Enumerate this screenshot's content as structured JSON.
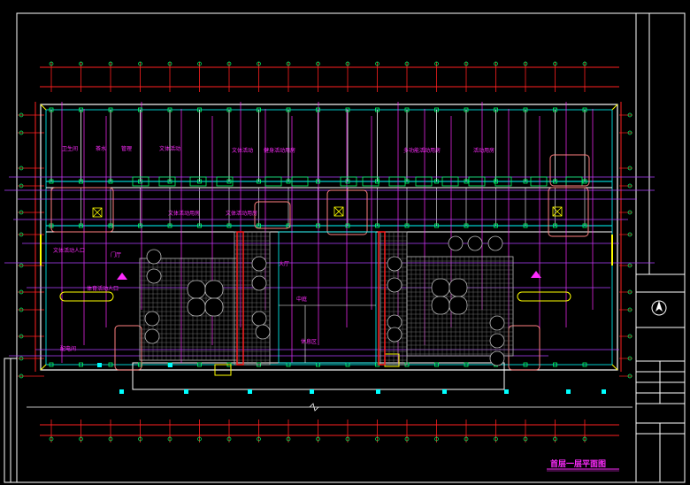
{
  "drawing": {
    "title": "首层一层平面图",
    "subtitle": "",
    "rooms": [
      {
        "id": "r1",
        "text": "卫生间"
      },
      {
        "id": "r2",
        "text": "茶水"
      },
      {
        "id": "r3",
        "text": "管理"
      },
      {
        "id": "r4",
        "text": "文体活动"
      },
      {
        "id": "r5",
        "text": "文体活动"
      },
      {
        "id": "r6",
        "text": "健身活动用房"
      },
      {
        "id": "r7",
        "text": "多功能活动用房"
      },
      {
        "id": "r8",
        "text": "活动用房"
      },
      {
        "id": "r9",
        "text": "文体活动用房"
      },
      {
        "id": "r10",
        "text": "文体活动用房"
      },
      {
        "id": "r11",
        "text": "文体活动人口"
      },
      {
        "id": "r12",
        "text": "体育活动人口"
      },
      {
        "id": "r13",
        "text": "门厅"
      },
      {
        "id": "r14",
        "text": "大厅"
      },
      {
        "id": "r15",
        "text": "中庭"
      },
      {
        "id": "r16",
        "text": "休息区"
      },
      {
        "id": "r17",
        "text": "配电间"
      }
    ]
  },
  "colors": {
    "background": "#000000",
    "frame": "#ffffff",
    "axis": "#ff2020",
    "grid": "#ffffff",
    "wall_cyan": "#00ffff",
    "wall_green": "#00ff66",
    "magenta": "#ff2bff",
    "yellow": "#ffff00",
    "orange": "#ff7f7f"
  }
}
